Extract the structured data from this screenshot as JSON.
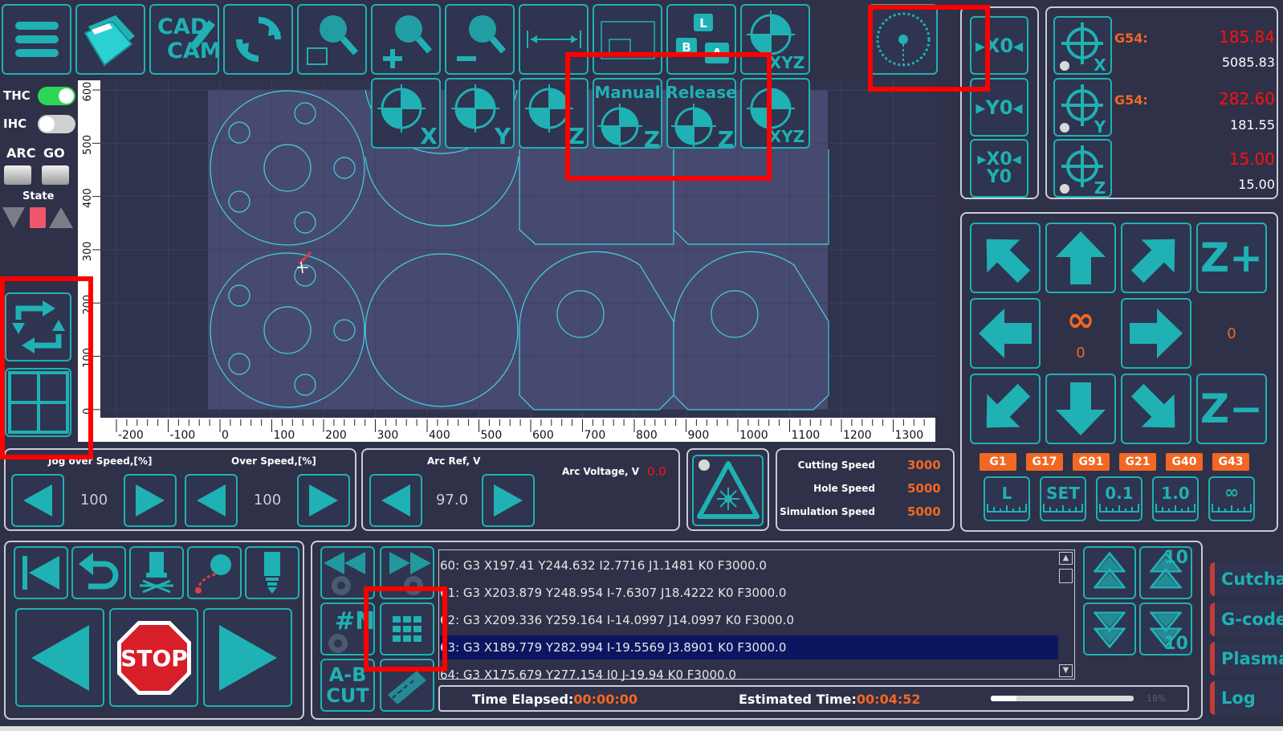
{
  "thc": {
    "label": "THC",
    "on": true
  },
  "ihc": {
    "label": "IHC",
    "on": false
  },
  "arc_go": {
    "arc": "ARC",
    "go": "GO"
  },
  "state_label": "State",
  "toolbar": {
    "cad_cam": {
      "line1": "CAD",
      "line2": "CAM"
    },
    "lba": {
      "l": "L",
      "b": "B",
      "a": "A"
    },
    "xyz_label": "XYZ",
    "probe_labels": [
      "X",
      "Y",
      "Z"
    ],
    "manual_label": "Manual",
    "release_label": "Release",
    "z_label": "Z",
    "xyz2_label": "XYZ"
  },
  "zero_buttons": {
    "x0": "X0",
    "y0": "Y0",
    "x0y0_l1": "X0",
    "x0y0_l2": "Y0"
  },
  "coords": [
    {
      "axis": "X",
      "wcs": "G54:",
      "work": "185.84",
      "machine": "5085.83"
    },
    {
      "axis": "Y",
      "wcs": "G54:",
      "work": "282.60",
      "machine": "181.55"
    },
    {
      "axis": "Z",
      "wcs": "",
      "work": "15.00",
      "machine": "15.00"
    }
  ],
  "jog": {
    "zplus": "Z+",
    "zminus": "Z−",
    "infinity": "∞",
    "center_value": "0",
    "right_value": "0"
  },
  "gcodes": [
    "G1",
    "G17",
    "G91",
    "G21",
    "G40",
    "G43"
  ],
  "steps": [
    "L",
    "SET",
    "0.1",
    "1.0",
    "∞"
  ],
  "plot": {
    "x_ticks": [
      "-200",
      "-100",
      "0",
      "100",
      "200",
      "300",
      "400",
      "500",
      "600",
      "700",
      "800",
      "900",
      "1000",
      "1100",
      "1200",
      "1300"
    ],
    "y_ticks": [
      "600",
      "500",
      "400",
      "300",
      "200",
      "100",
      "0"
    ]
  },
  "speeds": {
    "jog_over_label": "Jog over Speed,[%]",
    "jog_over_value": "100",
    "over_label": "Over Speed,[%]",
    "over_value": "100",
    "arc_ref_label": "Arc Ref, V",
    "arc_ref_value": "97.0",
    "arc_voltage_label": "Arc Voltage, V",
    "arc_voltage_value": "0.0"
  },
  "feeds": [
    {
      "label": "Cutting Speed",
      "value": "3000"
    },
    {
      "label": "Hole Speed",
      "value": "5000"
    },
    {
      "label": "Simulation Speed",
      "value": "5000"
    }
  ],
  "stop_label": "STOP",
  "nav": {
    "hash_n": "#N",
    "ab_cut_1": "A-B",
    "ab_cut_2": "CUT",
    "ten_top": "10",
    "ten_bottom": "10"
  },
  "gcode_lines": [
    {
      "text": "60: G3 X197.41 Y244.632 I2.7716 J1.1481 K0 F3000.0",
      "selected": false
    },
    {
      "text": "61: G3 X203.879 Y248.954 I-7.6307 J18.4222 K0 F3000.0",
      "selected": false
    },
    {
      "text": "62: G3 X209.336 Y259.164 I-14.0997 J14.0997 K0 F3000.0",
      "selected": false
    },
    {
      "text": "63: G3 X189.779 Y282.994 I-19.5569 J3.8901 K0 F3000.0",
      "selected": true
    },
    {
      "text": "64: G3 X175.679 Y277.154 I0 J-19.94 K0 F3000.0",
      "selected": false
    }
  ],
  "time": {
    "elapsed_label": "Time Elapsed:",
    "elapsed": "00:00:00",
    "estimated_label": "Estimated Time:",
    "estimated": "00:04:52",
    "progress_label": "18%",
    "progress": 0.18
  },
  "side_tabs": [
    "Cutchart",
    "G-code",
    "Plasma",
    "Log"
  ],
  "colors": {
    "accent": "#1fb1b3",
    "orange": "#f26722",
    "red": "#ff0000",
    "bg": "#2e3148"
  }
}
